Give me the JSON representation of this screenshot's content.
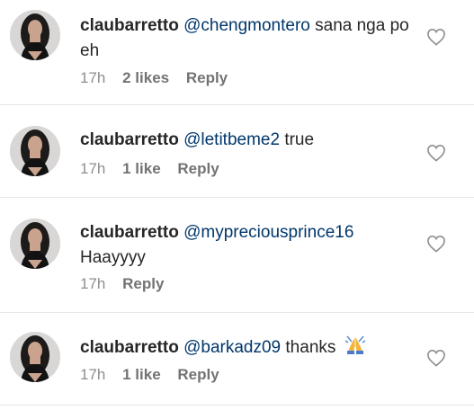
{
  "comments": [
    {
      "username": "claubarretto",
      "mention": "@chengmontero",
      "text": " sana nga po eh",
      "time": "17h",
      "likes": "2 likes",
      "reply": "Reply",
      "avatar_icon": "profile-photo",
      "like_icon": "heart-outline-icon"
    },
    {
      "username": "claubarretto",
      "mention": "@letitbeme2",
      "text": " true",
      "time": "17h",
      "likes": "1 like",
      "reply": "Reply",
      "avatar_icon": "profile-photo",
      "like_icon": "heart-outline-icon"
    },
    {
      "username": "claubarretto",
      "mention": "@mypreciousprince16",
      "text": "Haayyyy",
      "time": "17h",
      "likes": "",
      "reply": "Reply",
      "avatar_icon": "profile-photo",
      "like_icon": "heart-outline-icon"
    },
    {
      "username": "claubarretto",
      "mention": "@barkadz09",
      "text": " thanks",
      "emoji": "folded-hands-emoji",
      "time": "17h",
      "likes": "1 like",
      "reply": "Reply",
      "avatar_icon": "profile-photo",
      "like_icon": "heart-outline-icon"
    }
  ],
  "colors": {
    "text": "#262626",
    "mention": "#00376b",
    "meta": "#8e8e8e",
    "divider": "#e6e6e6"
  }
}
